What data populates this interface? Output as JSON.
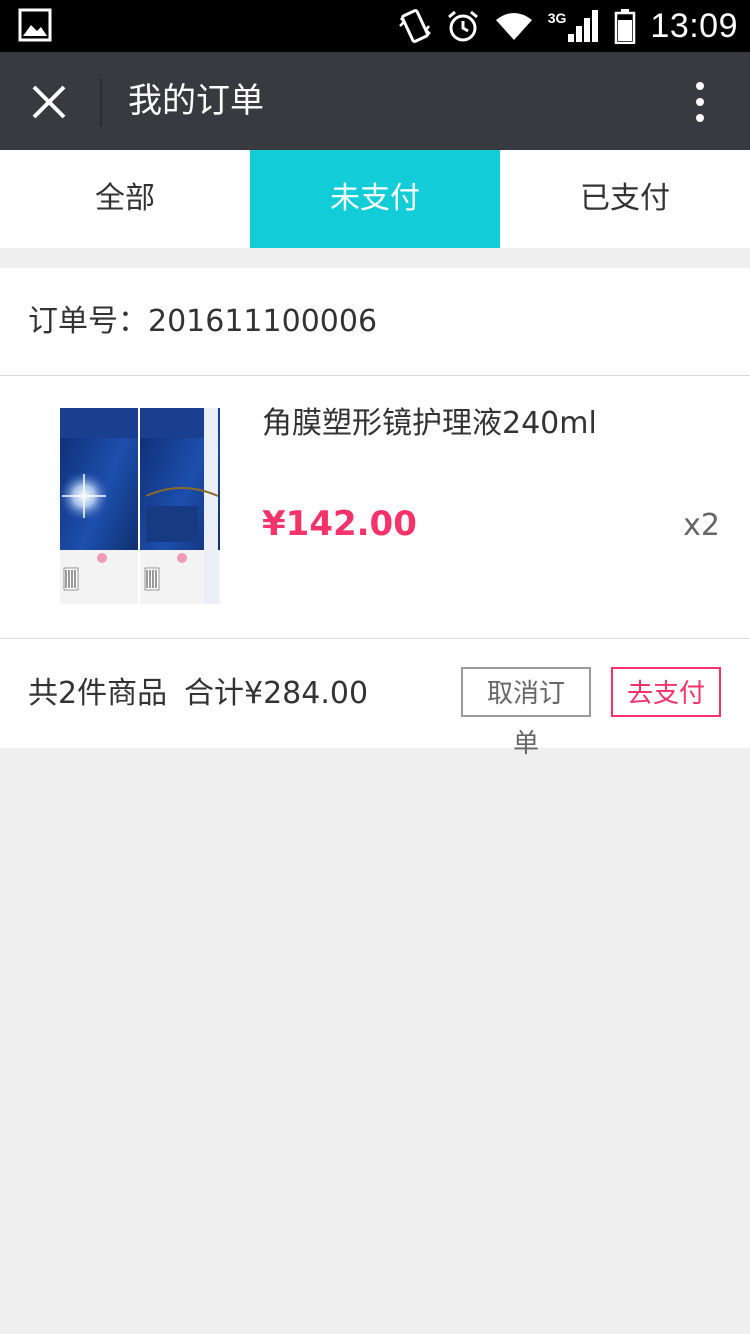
{
  "status_bar": {
    "time": "13:09",
    "network": "3G",
    "icons": [
      "gallery-icon",
      "vibrate-icon",
      "alarm-icon",
      "wifi-icon",
      "signal-icon",
      "battery-icon"
    ]
  },
  "header": {
    "title": "我的订单",
    "close_icon": "close-icon",
    "more_icon": "more-vertical-icon"
  },
  "tabs": [
    {
      "label": "全部",
      "active": false
    },
    {
      "label": "未支付",
      "active": true
    },
    {
      "label": "已支付",
      "active": false
    }
  ],
  "order": {
    "order_no_label": "订单号：",
    "order_no": "201611100006",
    "product": {
      "name": "角膜塑形镜护理液240ml",
      "price": "¥142.00",
      "quantity": "x2"
    },
    "summary": {
      "count_text": "共2件商品",
      "total_text": "合计¥284.00"
    },
    "buttons": {
      "cancel": "取消订单",
      "pay": "去支付"
    }
  },
  "colors": {
    "accent": "#12ccd8",
    "price": "#f5336a",
    "header_bg": "#393a3f",
    "page_bg": "#efefef"
  }
}
